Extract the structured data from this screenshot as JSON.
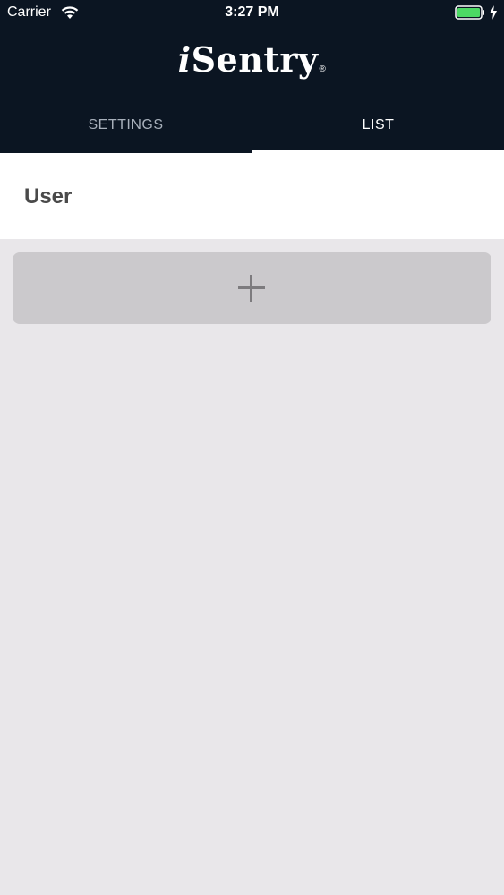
{
  "status_bar": {
    "carrier": "Carrier",
    "time": "3:27 PM",
    "wifi_icon": "wifi-icon",
    "battery_icon": "battery-charging-icon"
  },
  "header": {
    "logo_i": "i",
    "logo_rest": "Sentry",
    "logo_mark": "®"
  },
  "tabs": [
    {
      "label": "SETTINGS",
      "active": false
    },
    {
      "label": "LIST",
      "active": true
    }
  ],
  "section": {
    "title": "User"
  },
  "add_button": {
    "icon": "plus-icon"
  },
  "colors": {
    "header_bg": "#0b1522",
    "page_bg": "#e9e7ea",
    "battery": "#4cd964",
    "button_bg": "#cbc9cc"
  }
}
